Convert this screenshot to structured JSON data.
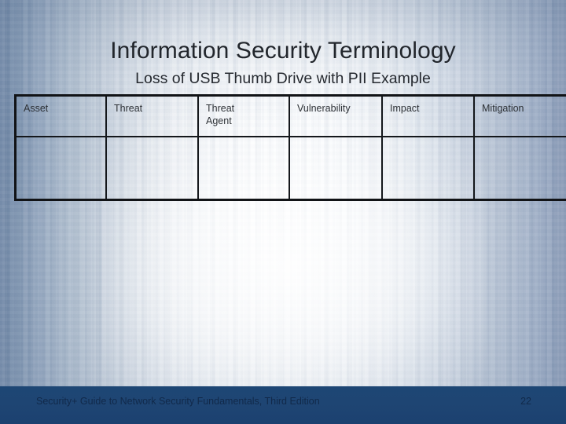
{
  "slide": {
    "title": "Information Security Terminology",
    "subtitle": "Loss of USB Thumb Drive with PII Example"
  },
  "table": {
    "columns": [
      {
        "label": "Asset"
      },
      {
        "label": "Threat"
      },
      {
        "label": "Threat\nAgent"
      },
      {
        "label": "Vulnerability"
      },
      {
        "label": "Impact"
      },
      {
        "label": "Mitigation"
      }
    ],
    "rows": [
      {
        "cells": [
          "",
          "",
          "",
          "",
          "",
          ""
        ]
      }
    ]
  },
  "footer": {
    "source": "Security+ Guide to Network Security Fundamentals, Third Edition",
    "page_number": "22"
  },
  "colors": {
    "footer_bar": "#1d4674",
    "footer_text": "#11294a",
    "title_text": "#22262c",
    "table_border": "#14171b",
    "background_edge": "#6b83a3",
    "background_center": "#fcfdfe"
  }
}
